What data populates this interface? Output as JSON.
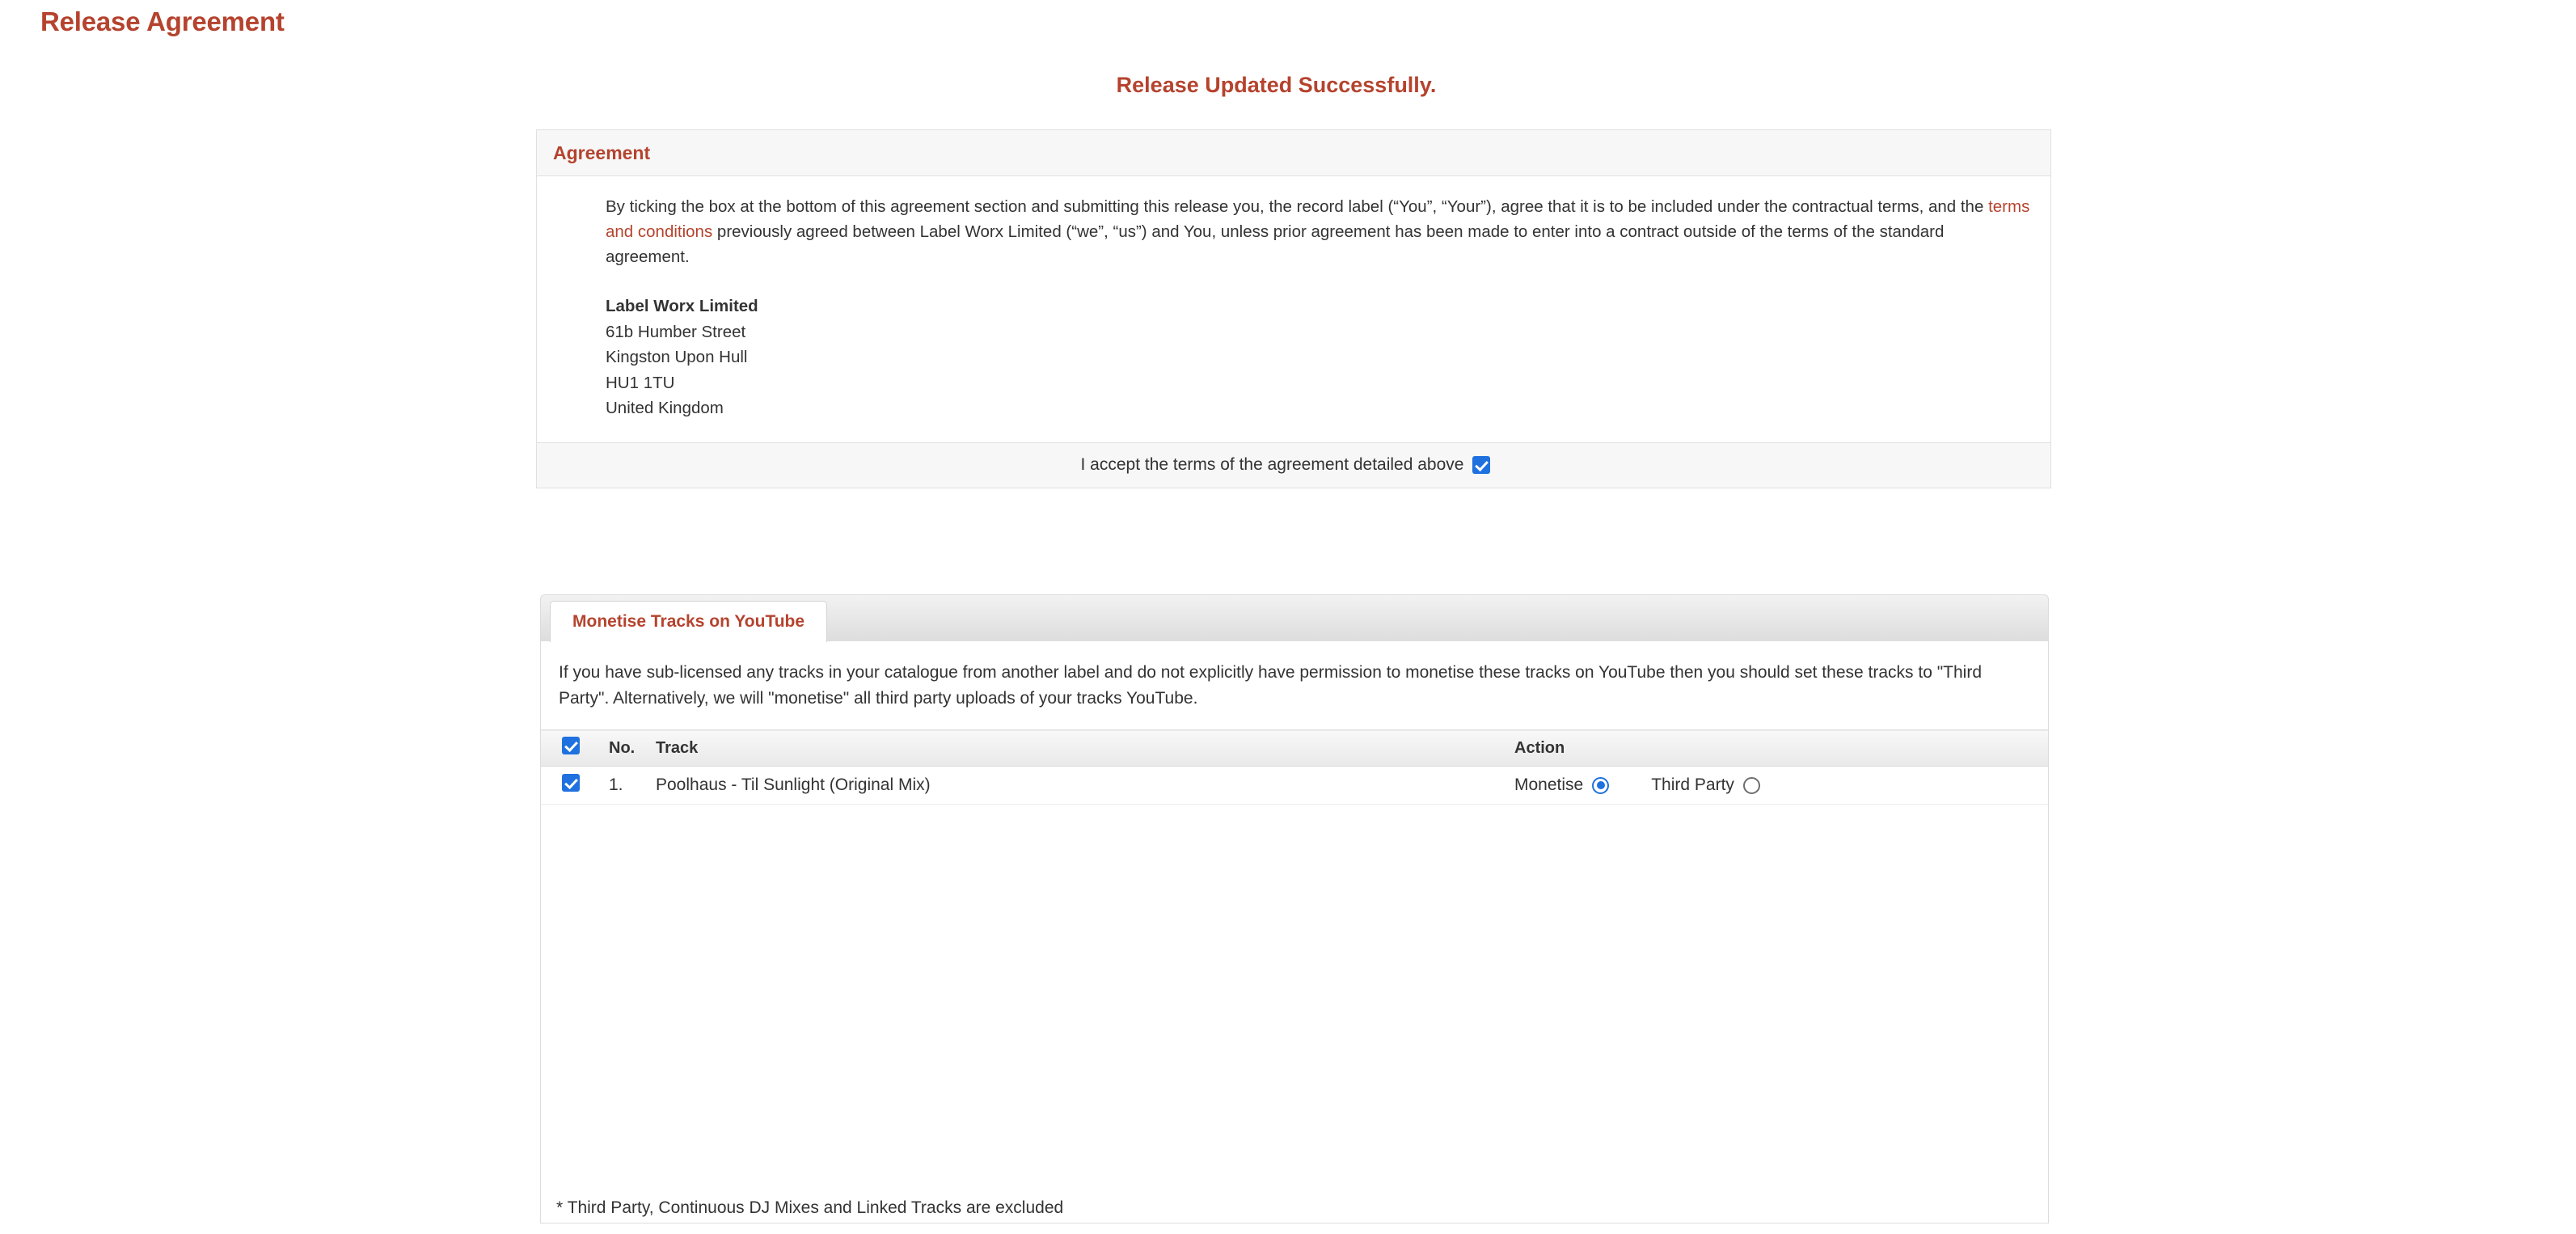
{
  "page": {
    "title": "Release Agreement",
    "success_message": "Release Updated Successfully."
  },
  "agreement": {
    "header_title": "Agreement",
    "paragraph_part1": "By ticking the box at the bottom of this agreement section and submitting this release you, the record label (“You”, “Your”), agree that it is to be included under the contractual terms, and the ",
    "link_text": "terms and conditions",
    "paragraph_part2": " previously agreed between Label Worx Limited (“we”, “us”) and You, unless prior agreement has been made to enter into a contract outside of the terms of the standard agreement.",
    "address": {
      "company": "Label Worx Limited",
      "line1": "61b Humber Street",
      "line2": "Kingston Upon Hull",
      "line3": "HU1 1TU",
      "line4": "United Kingdom"
    },
    "accept_label": "I accept the terms of the agreement detailed above",
    "accept_checked": true
  },
  "monetise": {
    "tab_label": "Monetise Tracks on YouTube",
    "description": "If you have sub-licensed any tracks in your catalogue from another label and do not explicitly have permission to monetise these tracks on YouTube then you should set these tracks to \"Third Party\". Alternatively, we will \"monetise\" all third party uploads of your tracks YouTube.",
    "table": {
      "headers": {
        "select_all_checked": true,
        "no": "No.",
        "track": "Track",
        "action": "Action"
      },
      "rows": [
        {
          "checked": true,
          "no": "1.",
          "track": "Poolhaus - Til Sunlight (Original Mix)",
          "monetise_label": "Monetise",
          "monetise_selected": true,
          "third_party_label": "Third Party",
          "third_party_selected": false
        }
      ]
    },
    "footnote": "* Third Party, Continuous DJ Mixes and Linked Tracks are excluded"
  },
  "colors": {
    "accent": "#b5432e",
    "control_blue": "#1f71e0",
    "panel_border": "#e0e0e0",
    "panel_header_bg": "#f7f7f7"
  }
}
